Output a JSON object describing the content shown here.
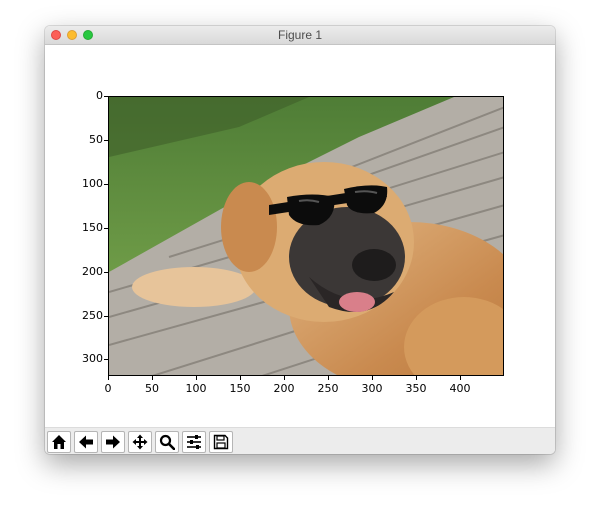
{
  "window": {
    "title": "Figure 1"
  },
  "axes": {
    "y_ticks": [
      "0",
      "50",
      "100",
      "150",
      "200",
      "250",
      "300"
    ],
    "x_ticks": [
      "0",
      "50",
      "100",
      "150",
      "200",
      "250",
      "300",
      "350",
      "400"
    ]
  },
  "image": {
    "subject": "dog-with-sunglasses-photo"
  },
  "toolbar": {
    "buttons": [
      {
        "icon": "home-icon",
        "name": "home-button"
      },
      {
        "icon": "arrow-left-icon",
        "name": "back-button"
      },
      {
        "icon": "arrow-right-icon",
        "name": "forward-button"
      },
      {
        "icon": "pan-icon",
        "name": "pan-button"
      },
      {
        "icon": "zoom-icon",
        "name": "zoom-button"
      },
      {
        "icon": "sliders-icon",
        "name": "configure-subplots-button"
      },
      {
        "icon": "save-icon",
        "name": "save-button"
      }
    ]
  },
  "colors": {
    "close": "#fc5f57",
    "minimize": "#fdbc2e",
    "zoom": "#28c840"
  }
}
